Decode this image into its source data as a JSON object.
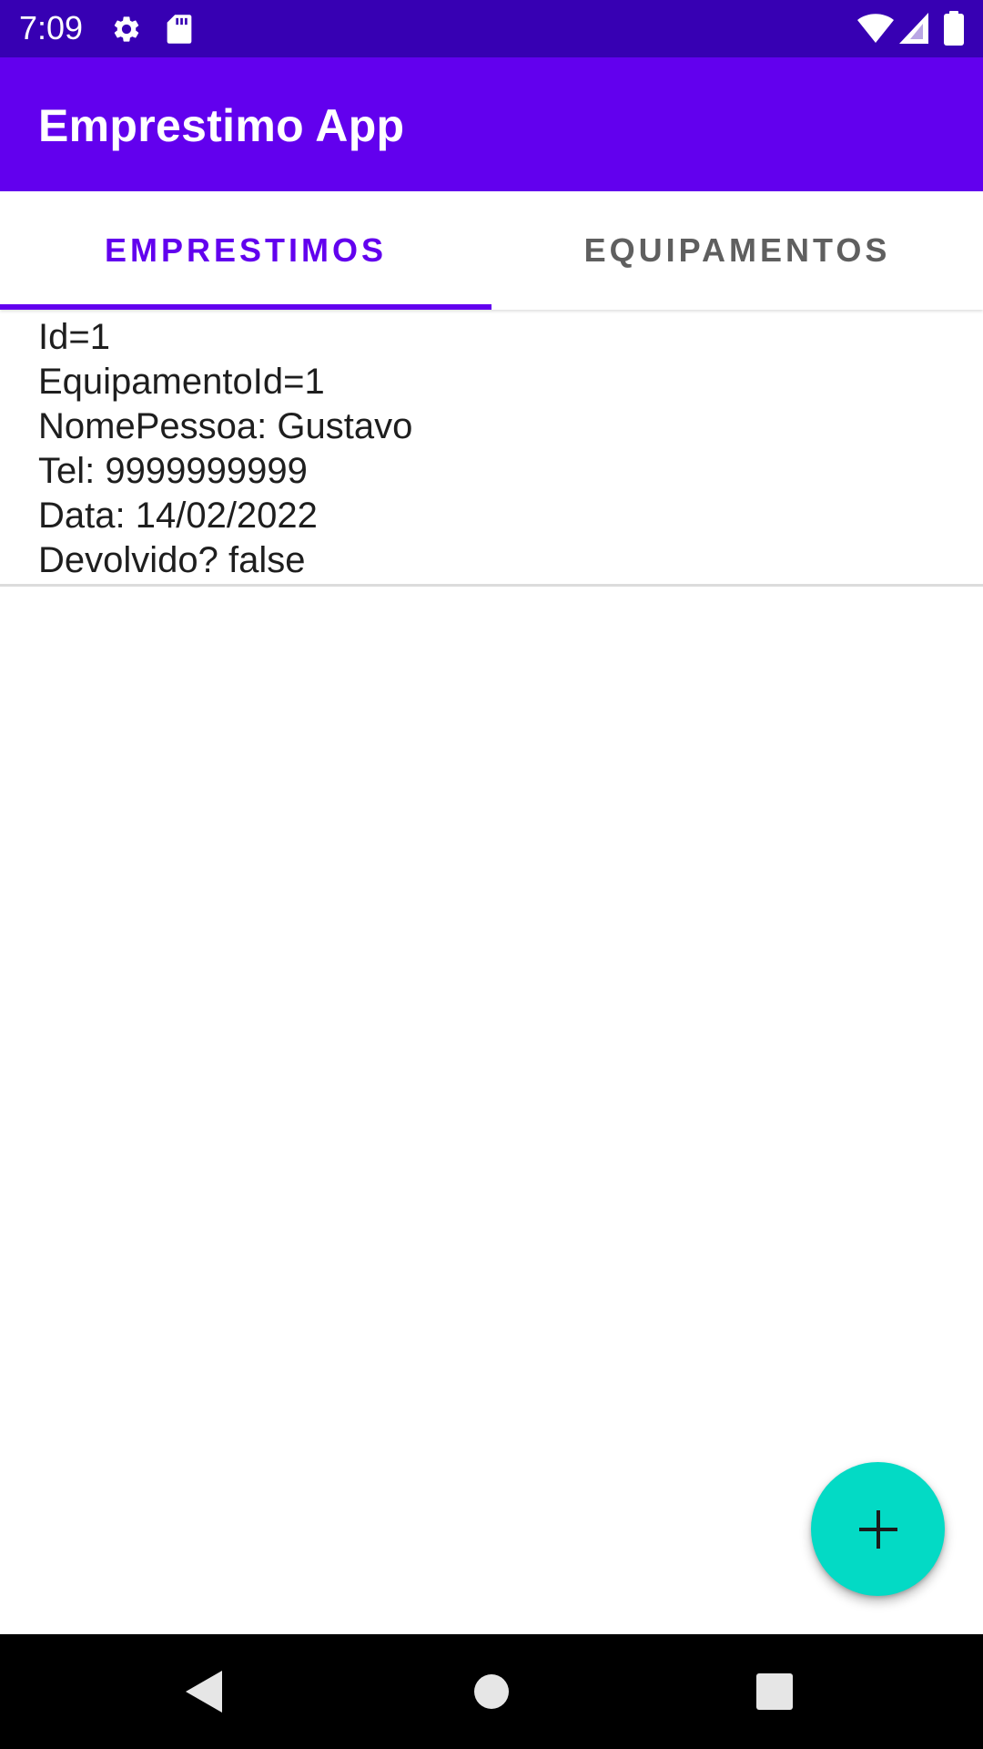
{
  "status_bar": {
    "time": "7:09",
    "icons": [
      "gear-icon",
      "sd-card-icon",
      "wifi-icon",
      "signal-icon",
      "battery-icon"
    ]
  },
  "app_bar": {
    "title": "Emprestimo App"
  },
  "tabs": [
    {
      "label": "EMPRESTIMOS",
      "selected": true
    },
    {
      "label": "EQUIPAMENTOS",
      "selected": false
    }
  ],
  "loans": [
    {
      "lines": [
        "Id=1",
        "EquipamentoId=1",
        "NomePessoa: Gustavo",
        "Tel: 9999999999",
        "Data: 14/02/2022",
        "Devolvido? false"
      ]
    }
  ],
  "fab": {
    "icon": "plus-icon"
  },
  "nav_bar": {
    "icons": [
      "back-icon",
      "home-icon",
      "recents-icon"
    ]
  },
  "colors": {
    "status_bar": "#3700b3",
    "primary": "#6200ee",
    "accent": "#03dac5",
    "tab_inactive": "#5f5f5f",
    "text": "#1e1e1e"
  }
}
